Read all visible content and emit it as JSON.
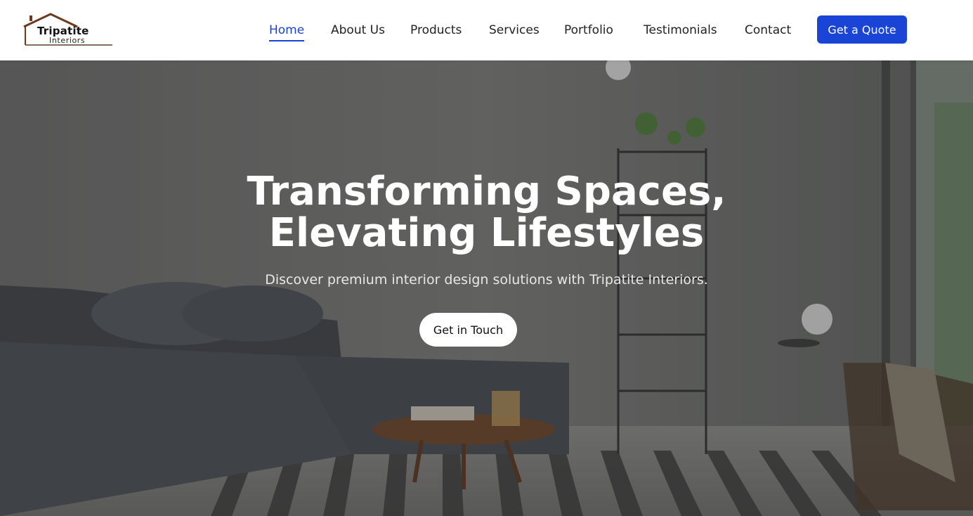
{
  "brand": {
    "name": "Tripatite",
    "subtitle": "Interiors",
    "accent_color": "#1a44d6",
    "logo_roof_color": "#6b3a1f"
  },
  "nav": {
    "items": [
      {
        "label": "Home",
        "active": true
      },
      {
        "label": "About Us",
        "active": false
      },
      {
        "label": "Products",
        "active": false
      },
      {
        "label": "Services",
        "active": false
      },
      {
        "label": "Portfolio",
        "active": false
      },
      {
        "label": "Testimonials",
        "active": false
      },
      {
        "label": "Contact",
        "active": false
      }
    ],
    "cta_label": "Get a Quote"
  },
  "hero": {
    "title_line1": "Transforming Spaces,",
    "title_line2": "Elevating Lifestyles",
    "subtitle": "Discover premium interior design solutions with Tripatite Interiors.",
    "cta_label": "Get in Touch",
    "image_description_icon": "living-room-photo"
  }
}
